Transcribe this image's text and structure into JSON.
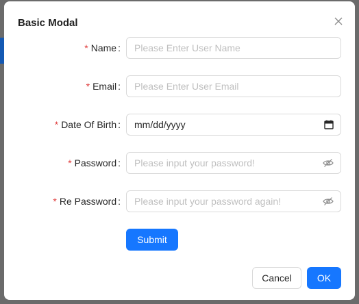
{
  "modal": {
    "title": "Basic Modal",
    "close_icon": "close-icon"
  },
  "form": {
    "fields": [
      {
        "label": "Name",
        "placeholder": "Please Enter User Name",
        "required": true,
        "type": "text"
      },
      {
        "label": "Email",
        "placeholder": "Please Enter User Email",
        "required": true,
        "type": "email"
      },
      {
        "label": "Date Of Birth",
        "value": "mm/dd/yyyy",
        "required": true,
        "type": "date",
        "icon": "calendar-icon"
      },
      {
        "label": "Password",
        "placeholder": "Please input your password!",
        "required": true,
        "type": "password",
        "icon": "eye-invisible-icon"
      },
      {
        "label": "Re Password",
        "placeholder": "Please input your password again!",
        "required": true,
        "type": "password",
        "icon": "eye-invisible-icon"
      }
    ],
    "required_mark": "*",
    "colon": ":",
    "submit_label": "Submit"
  },
  "footer": {
    "cancel_label": "Cancel",
    "ok_label": "OK"
  },
  "colors": {
    "primary": "#1677ff",
    "required": "#e03d3d",
    "border": "#d9d9d9",
    "placeholder": "#bfbfbf"
  }
}
